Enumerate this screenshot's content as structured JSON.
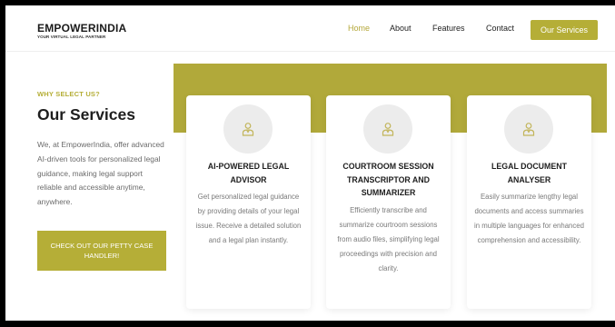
{
  "header": {
    "logo_title": "EMPOWERINDIA",
    "logo_subtitle": "YOUR VIRTUAL LEGAL PARTNER",
    "nav": {
      "home": "Home",
      "about": "About",
      "features": "Features",
      "contact": "Contact",
      "services_button": "Our Services"
    }
  },
  "intro": {
    "eyebrow": "WHY SELECT US?",
    "title": "Our Services",
    "description": "We, at EmpowerIndia, offer advanced AI-driven tools for personalized legal guidance, making legal support reliable and accessible anytime, anywhere.",
    "cta_label": "CHECK OUT OUR PETTY CASE HANDLER!"
  },
  "cards": [
    {
      "icon": "lawyer-icon",
      "title": "AI-POWERED LEGAL ADVISOR",
      "description": "Get personalized legal guidance by providing details of your legal issue. Receive a detailed solution and a legal plan instantly."
    },
    {
      "icon": "lawyer-icon",
      "title": "COURTROOM SESSION TRANSCRIPTOR AND SUMMARIZER",
      "description": "Efficiently transcribe and summarize courtroom sessions from audio files, simplifying legal proceedings with precision and clarity."
    },
    {
      "icon": "lawyer-icon",
      "title": "LEGAL DOCUMENT ANALYSER",
      "description": "Easily summarize lengthy legal documents and access summaries in multiple languages for enhanced comprehension and accessibility."
    }
  ],
  "colors": {
    "accent": "#b5ae37",
    "nav_active": "#b5a83a",
    "band": "#b1a93a",
    "icon_circle": "#ececec",
    "icon_stroke": "#c2b55a"
  }
}
